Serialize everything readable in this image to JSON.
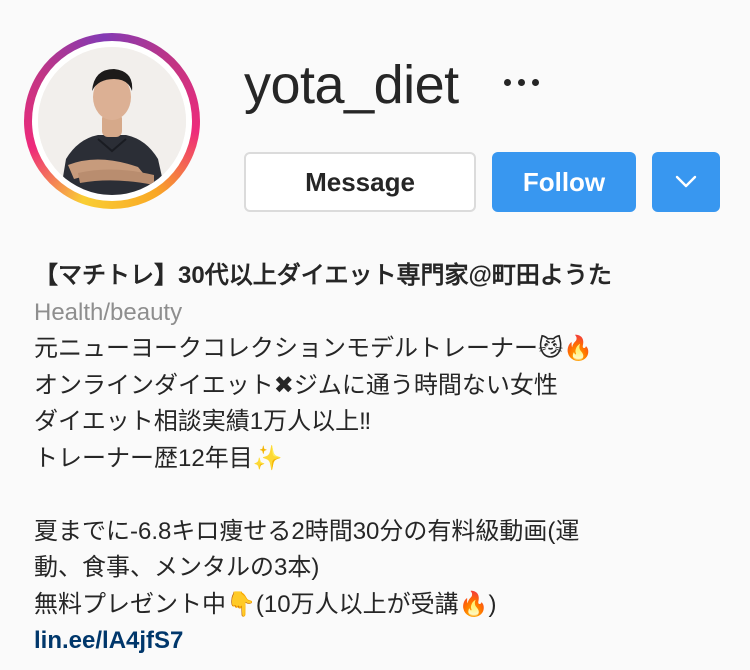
{
  "profile": {
    "username": "yota_diet",
    "more_icon": "more-horizontal-icon",
    "dropdown_icon": "chevron-down-icon"
  },
  "actions": {
    "message_label": "Message",
    "follow_label": "Follow"
  },
  "bio": {
    "full_name": "【マチトレ】30代以上ダイエット専門家@町田ようた",
    "category": "Health/beauty",
    "lines": [
      "元ニューヨークコレクションモデルトレーナー😼🔥",
      "オンラインダイエット✖ジムに通う時間ない女性",
      "ダイエット相談実績1万人以上‼",
      "トレーナー歴12年目✨",
      "",
      "夏までに-6.8キロ痩せる2時間30分の有料級動画(運",
      "動、食事、メンタルの3本)",
      "無料プレゼント中👇(10万人以上が受講🔥)"
    ],
    "link": "lin.ee/lA4jfS7"
  },
  "colors": {
    "follow_blue": "#3897f0",
    "link_blue": "#00376b",
    "category_gray": "#8e8e8e",
    "ring_start": "#f9ce34",
    "ring_mid": "#ee2a7b",
    "ring_end": "#833ab4"
  }
}
